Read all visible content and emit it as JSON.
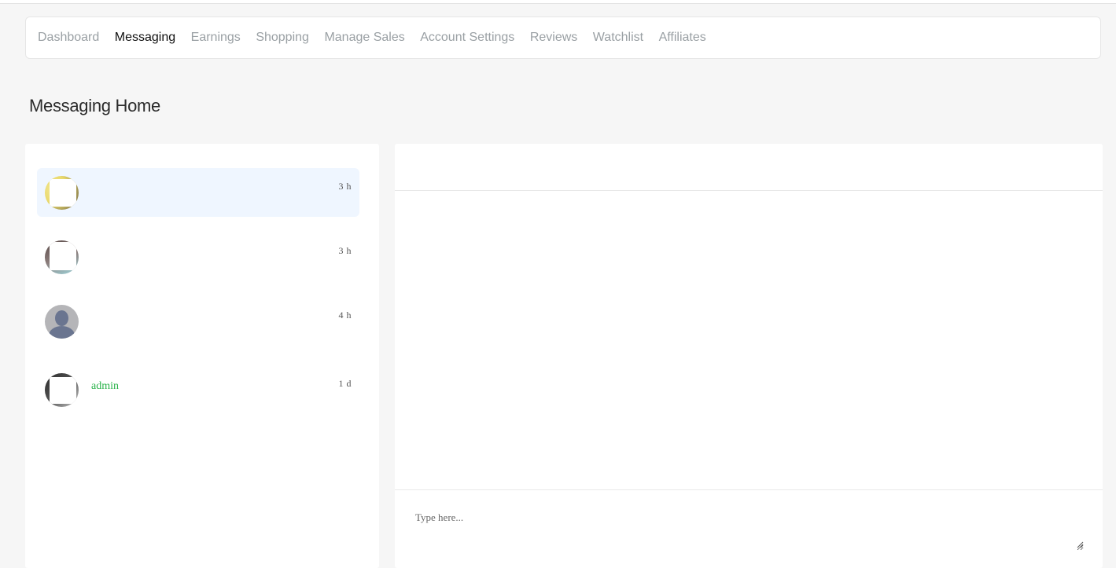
{
  "nav": {
    "items": [
      {
        "label": "Dashboard",
        "active": false
      },
      {
        "label": "Messaging",
        "active": true
      },
      {
        "label": "Earnings",
        "active": false
      },
      {
        "label": "Shopping",
        "active": false
      },
      {
        "label": "Manage Sales",
        "active": false
      },
      {
        "label": "Account Settings",
        "active": false
      },
      {
        "label": "Reviews",
        "active": false
      },
      {
        "label": "Watchlist",
        "active": false
      },
      {
        "label": "Affiliates",
        "active": false
      }
    ]
  },
  "page": {
    "title": "Messaging Home"
  },
  "conversations": [
    {
      "name": "",
      "time": "3 h",
      "selected": true,
      "avatar": "photo-avatar-icon"
    },
    {
      "name": "",
      "time": "3 h",
      "selected": false,
      "avatar": "photo-avatar-icon"
    },
    {
      "name": "",
      "time": "4 h",
      "selected": false,
      "avatar": "default-user-avatar-icon"
    },
    {
      "name": "admin",
      "time": "1 d",
      "selected": false,
      "avatar": "photo-avatar-icon"
    }
  ],
  "chat": {
    "input_placeholder": "Type here...",
    "input_value": ""
  },
  "colors": {
    "active_nav": "#111111",
    "inactive_nav": "#9aa0a4",
    "selected_conversation_bg": "#eff6ff",
    "username_green": "#2bb34b"
  }
}
